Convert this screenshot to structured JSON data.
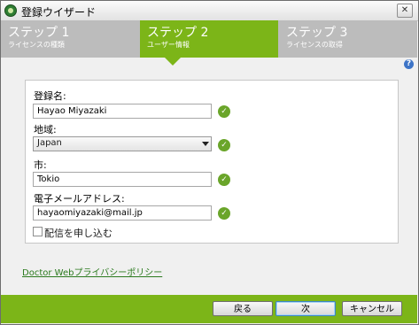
{
  "window": {
    "title": "登録ウイザード",
    "close_label": "✕"
  },
  "steps": [
    {
      "title": "ステップ 1",
      "subtitle": "ライセンスの種類"
    },
    {
      "title": "ステップ 2",
      "subtitle": "ユーザー情報"
    },
    {
      "title": "ステップ 3",
      "subtitle": "ライセンスの取得"
    }
  ],
  "help_label": "?",
  "form": {
    "name_label": "登録名:",
    "name_value": "Hayao Miyazaki",
    "region_label": "地域:",
    "region_value": "Japan",
    "city_label": "市:",
    "city_value": "Tokio",
    "email_label": "電子メールアドレス:",
    "email_value": "hayaomiyazaki@mail.jp",
    "subscribe_label": "配信を申し込む",
    "valid_mark": "✓"
  },
  "privacy_link": "Doctor Webプライバシーポリシー",
  "buttons": {
    "back": "戻る",
    "next": "次",
    "cancel": "キャンセル"
  },
  "colors": {
    "accent": "#7cb518",
    "inactive_step": "#bcbcbc",
    "link": "#2b7a1e"
  },
  "icons": {
    "app": "dr-web-spider-icon",
    "valid": "check-circle-icon",
    "help": "help-icon"
  }
}
